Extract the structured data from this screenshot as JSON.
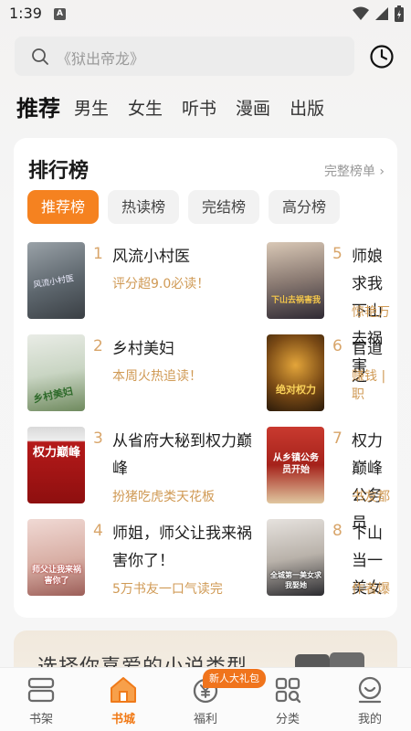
{
  "status": {
    "time": "1:39",
    "badge": "A"
  },
  "search": {
    "placeholder": "《狱出帝龙》"
  },
  "tabs": [
    "推荐",
    "男生",
    "女生",
    "听书",
    "漫画",
    "出版"
  ],
  "ranking": {
    "title": "排行榜",
    "more": "完整榜单 ›",
    "pills": [
      "推荐榜",
      "热读榜",
      "完结榜",
      "高分榜"
    ],
    "books": [
      {
        "rank": "1",
        "title": "风流小村医",
        "tag": "评分超9.0必读！"
      },
      {
        "rank": "2",
        "title": "乡村美妇",
        "tag": "本周火热追读！"
      },
      {
        "rank": "3",
        "title": "从省府大秘到权力巅峰",
        "tag": "扮猪吃虎类天花板"
      },
      {
        "rank": "4",
        "title": "师姐，师父让我来祸害你了！",
        "tag": "5万书友一口气读完"
      },
      {
        "rank": "5",
        "title": "师娘求我下山去祸害",
        "tag": "惊艳万"
      },
      {
        "rank": "6",
        "title": "官道之",
        "tag": "赚钱 | 职"
      },
      {
        "rank": "7",
        "title": "权力巅峰公务员",
        "tag": "书友都"
      },
      {
        "rank": "8",
        "title": "下山当一美女",
        "tag": "作者爆"
      }
    ],
    "cover_texts": [
      "风流小村医",
      "乡村美妇",
      "权力巅峰",
      "师父让我来祸害你了",
      "下山去祸害我",
      "绝对权力",
      "从乡镇公务员开始",
      "全城第一美女求我娶她"
    ]
  },
  "promo": {
    "text": "选择你喜爱的小说类型"
  },
  "nav": {
    "items": [
      "书架",
      "书城",
      "福利",
      "分类",
      "我的"
    ],
    "active": "书城",
    "gift_badge": "新人大礼包"
  },
  "colors": {
    "accent": "#f58220",
    "tag": "#d09a55",
    "rank": "#d8a56a"
  }
}
